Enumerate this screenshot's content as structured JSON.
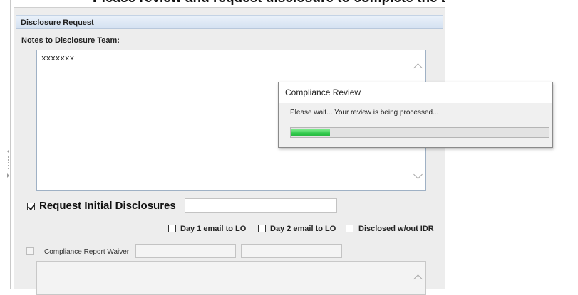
{
  "top_cut_text": "Please review and request disclosure to complete the LO compliance disclosure request",
  "section": {
    "title": "Disclosure Request"
  },
  "notes": {
    "label": "Notes to Disclosure Team:",
    "value": "xxxxxxx"
  },
  "request_initial": {
    "label": "Request Initial Disclosures",
    "checked": true
  },
  "options": {
    "day1": "Day 1 email to LO",
    "day2": "Day 2 email to LO",
    "disclosed": "Disclosed w/out IDR"
  },
  "waiver": {
    "label": "Compliance Report Waiver"
  },
  "dialog": {
    "title": "Compliance Review",
    "message": "Please wait...  Your review is being processed...",
    "progress_fraction": 0.15
  },
  "colors": {
    "progress": "#2fc84b",
    "header": "#d4e1f1"
  },
  "icons": [
    "scroll-up-icon",
    "scroll-down-icon",
    "checkmark-icon",
    "collapse-handle-icon"
  ]
}
